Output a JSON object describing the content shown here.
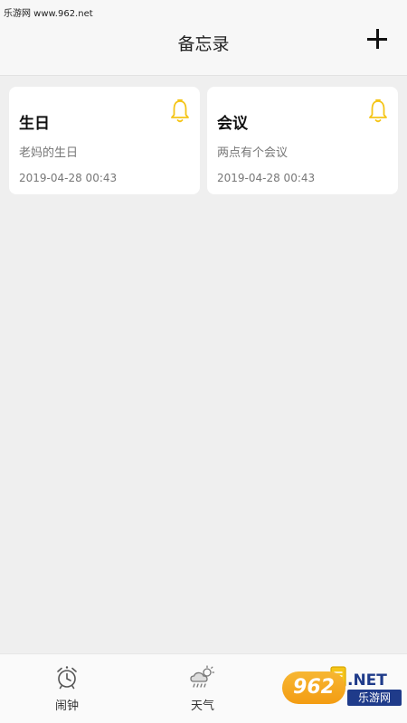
{
  "watermark_top": "乐游网 www.962.net",
  "header": {
    "title": "备忘录",
    "add_icon": "plus-icon"
  },
  "notes": [
    {
      "title": "生日",
      "description": "老妈的生日",
      "datetime": "2019-04-28 00:43",
      "icon": "bell-icon"
    },
    {
      "title": "会议",
      "description": "两点有个会议",
      "datetime": "2019-04-28 00:43",
      "icon": "bell-icon"
    }
  ],
  "bottom_nav": [
    {
      "label": "闹钟",
      "icon": "alarm-clock-icon"
    },
    {
      "label": "天气",
      "icon": "weather-icon"
    },
    {
      "label": "",
      "icon": "memo-icon"
    }
  ],
  "watermark_logo": {
    "number": "962",
    "suffix": ".NET",
    "text": "乐游网"
  },
  "colors": {
    "accent_bell": "#f5c518",
    "background": "#efefef",
    "card": "#ffffff"
  }
}
